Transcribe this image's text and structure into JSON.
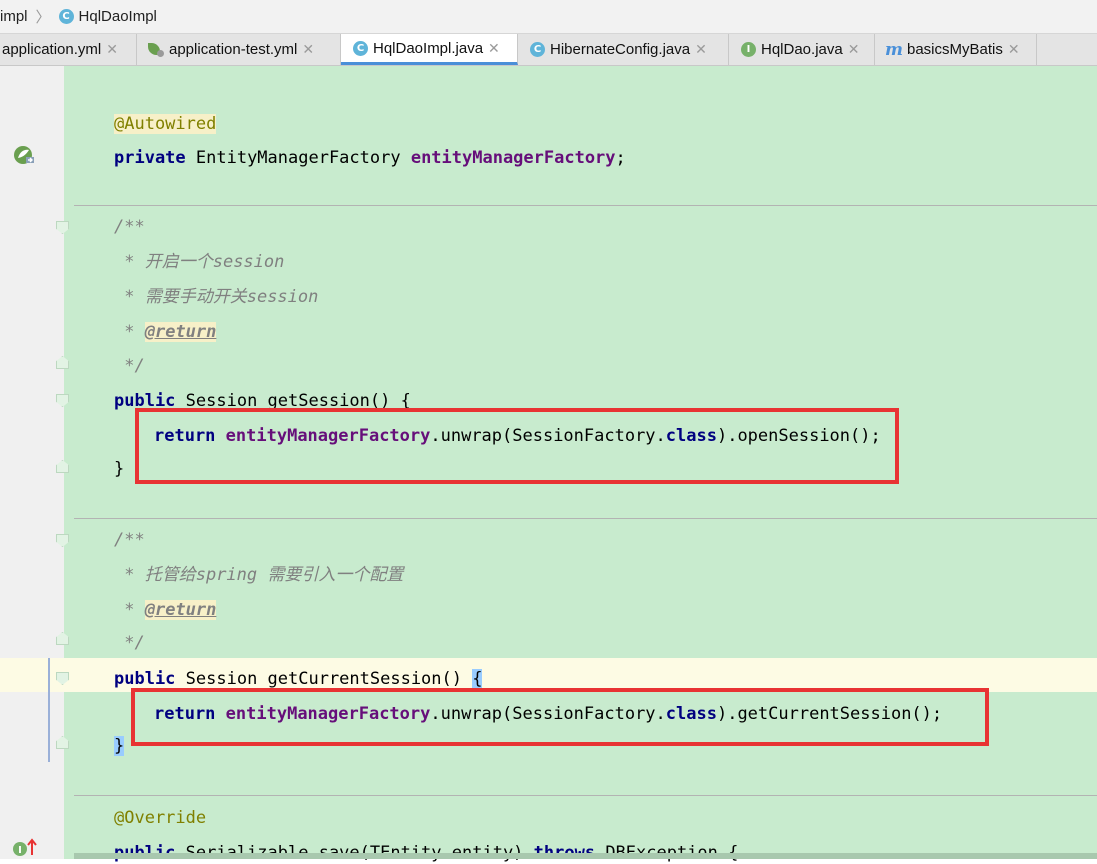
{
  "breadcrumb": {
    "first": "impl",
    "second": "HqlDaoImpl"
  },
  "icons": {
    "class": "C",
    "interface": "I",
    "mybatis": "m"
  },
  "tabs": [
    {
      "label": "application.yml"
    },
    {
      "label": "application-test.yml"
    },
    {
      "label": "HqlDaoImpl.java"
    },
    {
      "label": "HibernateConfig.java"
    },
    {
      "label": "HqlDao.java"
    },
    {
      "label": "basicsMyBatis"
    }
  ],
  "code": {
    "autowired": "@Autowired",
    "private_kw": "private",
    "factory_type": " EntityManagerFactory ",
    "factory_field": "entityManagerFactory",
    "semi": ";",
    "doc_open": "/**",
    "c1_prefix": " * ",
    "c1_text": "开启一个session",
    "c2_text": "需要手动开关session",
    "return_tag": "@return",
    "doc_close": " */",
    "public_kw": "public",
    "get_session_sig": " Session getSession() {",
    "return_kw": "return",
    "unwrap_text": ".unwrap(SessionFactory.",
    "class_kw": "class",
    "open_session_tail": ").openSession();",
    "close_brace": "}",
    "c3_text": "托管给spring 需要引入一个配置",
    "get_current_sig": " Session getCurrentSession() ",
    "open_brace": "{",
    "current_session_tail": ").getCurrentSession();",
    "override": "@Override",
    "save_mid": " Serializable save(TEntity entity) ",
    "throws_kw": "throws",
    "save_tail": " DBException {"
  },
  "colors": {
    "keyword": "#000080",
    "field": "#660e7a",
    "annotation": "#808000",
    "comment": "#808080",
    "highlight_box": "#e83333",
    "change_bg": "#c8ebce"
  }
}
